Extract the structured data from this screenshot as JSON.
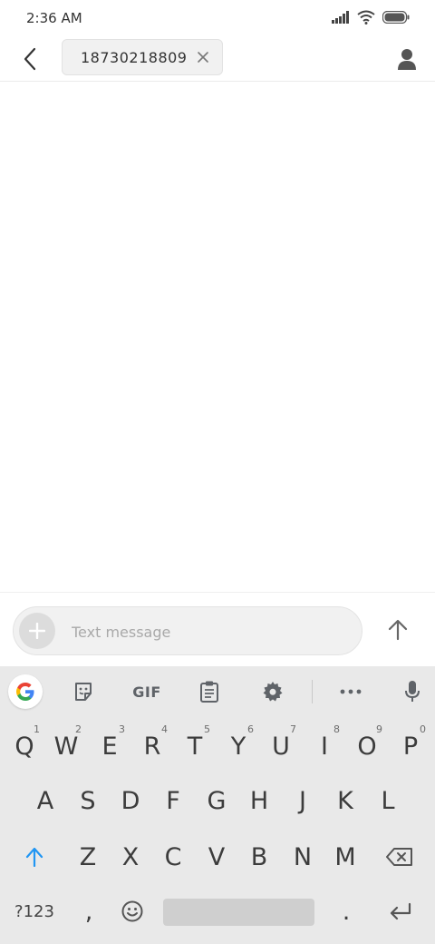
{
  "status_bar": {
    "time": "2:36 AM"
  },
  "header": {
    "recipient": "18730218809"
  },
  "composer": {
    "placeholder": "Text message"
  },
  "keyboard": {
    "toolbar": {
      "gif_label": "GIF"
    },
    "row1": [
      {
        "letter": "Q",
        "hint": "1"
      },
      {
        "letter": "W",
        "hint": "2"
      },
      {
        "letter": "E",
        "hint": "3"
      },
      {
        "letter": "R",
        "hint": "4"
      },
      {
        "letter": "T",
        "hint": "5"
      },
      {
        "letter": "Y",
        "hint": "6"
      },
      {
        "letter": "U",
        "hint": "7"
      },
      {
        "letter": "I",
        "hint": "8"
      },
      {
        "letter": "O",
        "hint": "9"
      },
      {
        "letter": "P",
        "hint": "0"
      }
    ],
    "row2": [
      "A",
      "S",
      "D",
      "F",
      "G",
      "H",
      "J",
      "K",
      "L"
    ],
    "row3": [
      "Z",
      "X",
      "C",
      "V",
      "B",
      "N",
      "M"
    ],
    "symbols_label": "?123",
    "comma": ",",
    "period": "."
  },
  "colors": {
    "shift_accent": "#2196f3",
    "keyboard_bg": "#e9e9e9",
    "chip_bg": "#f1f1f1"
  },
  "icons": [
    "back-arrow-icon",
    "contact-icon",
    "chip-close-icon",
    "plus-icon",
    "send-arrow-icon",
    "google-icon",
    "sticker-icon",
    "clipboard-icon",
    "gear-icon",
    "more-dots-icon",
    "microphone-icon",
    "shift-icon",
    "backspace-icon",
    "emoji-icon",
    "enter-icon",
    "signal-icon",
    "wifi-icon",
    "battery-icon"
  ]
}
